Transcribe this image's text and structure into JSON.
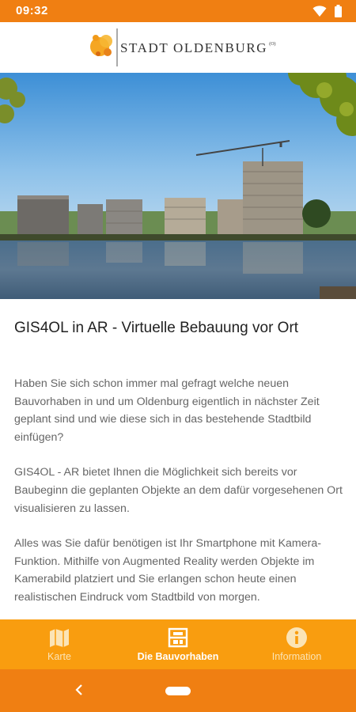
{
  "status_bar": {
    "time": "09:32",
    "icons": [
      "wifi-icon",
      "battery-icon"
    ]
  },
  "header": {
    "logo_text": "STADT OLDENBURG",
    "logo_superscript": "(O)"
  },
  "hero_image": {
    "icon": "construction-photo"
  },
  "article": {
    "title": "GIS4OL in AR - Virtuelle Bebauung vor Ort",
    "paragraphs": [
      "Haben Sie sich schon immer mal gefragt welche neuen Bauvorhaben in und um Oldenburg eigentlich in nächster Zeit geplant sind und wie diese sich in das bestehende Stadtbild einfügen?",
      "GIS4OL - AR bietet Ihnen die Möglichkeit sich bereits vor Baubeginn die geplanten Objekte an dem dafür vorgesehenen Ort visualisieren zu lassen.",
      "Alles was Sie dafür benötigen ist Ihr Smartphone mit Kamera-Funktion. Mithilfe von Augmented Reality werden Objekte im Kamerabild platziert und Sie erlangen schon heute einen realistischen Eindruck vom Stadtbild von morgen."
    ]
  },
  "bottom_nav": {
    "active_tab": "Die Bauvorhaben",
    "items": [
      {
        "label": "Karte",
        "icon": "map-icon"
      },
      {
        "label": "Die Bauvorhaben",
        "icon": "projects-icon"
      },
      {
        "label": "Information",
        "icon": "info-icon"
      }
    ]
  },
  "system_nav": {
    "icons": [
      "back-icon",
      "home-icon"
    ]
  },
  "colors": {
    "status_bar": "#f07f12",
    "bottom_nav": "#f99d0f",
    "active_label": "#ffffff",
    "inactive_label": "#fbe4b6"
  }
}
